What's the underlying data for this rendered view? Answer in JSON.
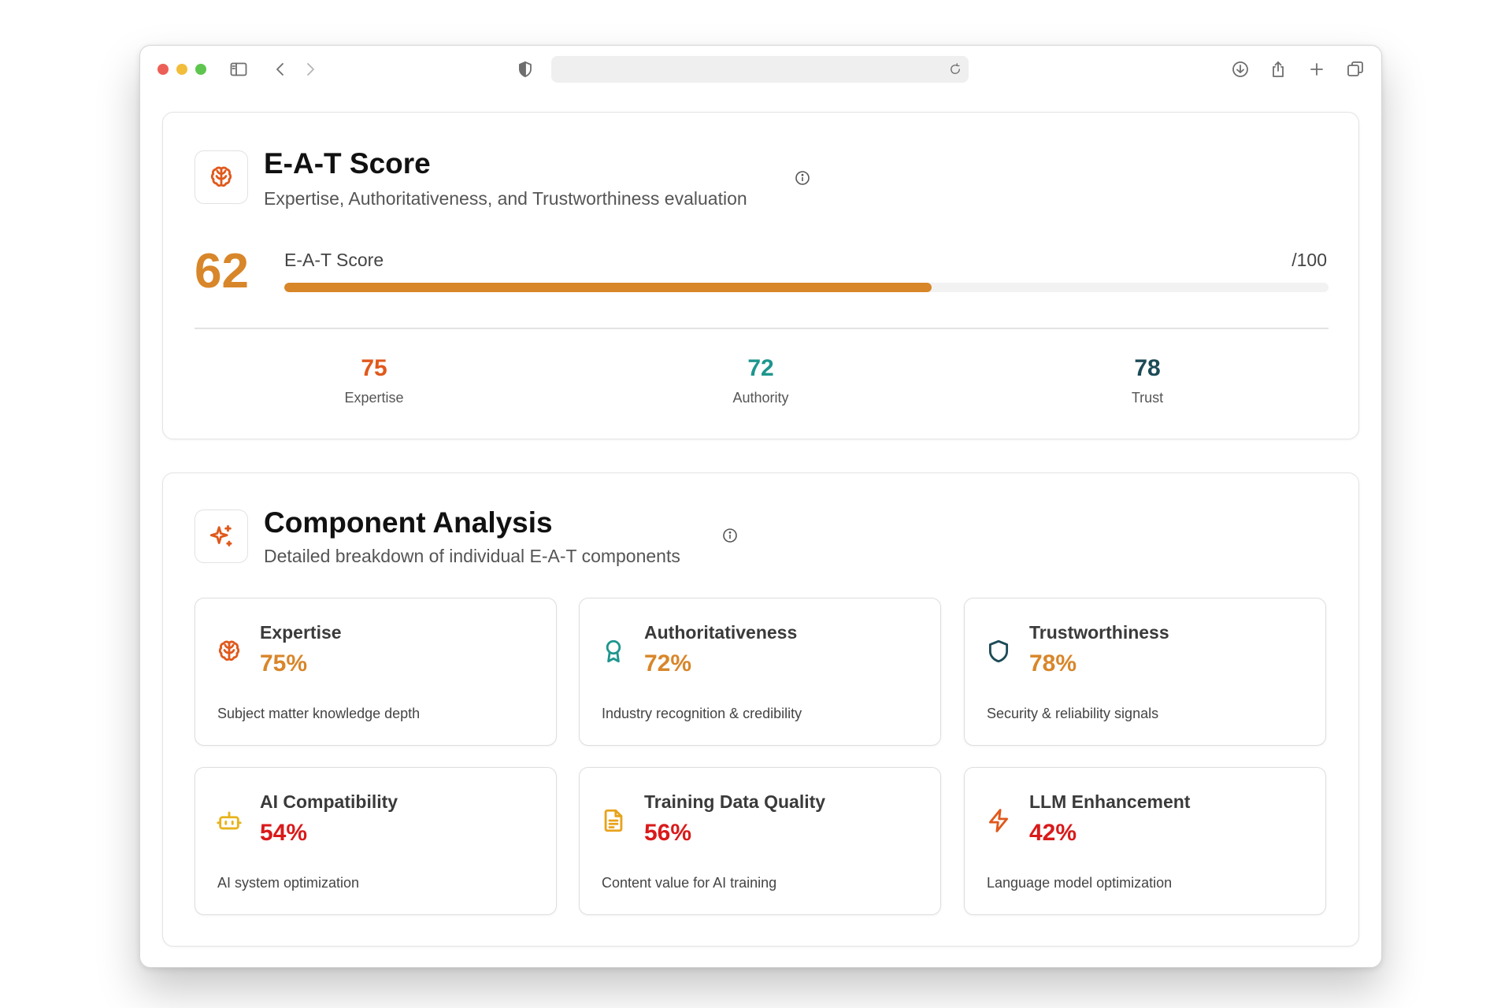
{
  "colors": {
    "accent": "#d8862a",
    "expertise": "#e0591c",
    "authority": "#1e968e",
    "trust": "#1c4b57",
    "low": "#d91a1a",
    "mid": "#d8862a"
  },
  "toolbar_icons": [
    "sidebar-icon",
    "back-icon",
    "forward-icon",
    "shield-icon",
    "reload-icon",
    "download-icon",
    "share-icon",
    "new-tab-icon",
    "tabs-icon"
  ],
  "eat_card": {
    "icon": "brain-icon",
    "title": "E-A-T Score",
    "subtitle": "Expertise, Authoritativeness, and Trustworthiness evaluation",
    "score": "62",
    "score_fraction": 0.62,
    "bar_label": "E-A-T Score",
    "bar_max": "/100",
    "sub_scores": [
      {
        "value": "75",
        "label": "Expertise"
      },
      {
        "value": "72",
        "label": "Authority"
      },
      {
        "value": "78",
        "label": "Trust"
      }
    ]
  },
  "component_card": {
    "icon": "sparkles-icon",
    "title": "Component Analysis",
    "subtitle": "Detailed breakdown of individual E-A-T components",
    "components": [
      {
        "icon": "brain-icon",
        "title": "Expertise",
        "value": "75%",
        "desc": "Subject matter knowledge depth"
      },
      {
        "icon": "award-icon",
        "title": "Authoritativeness",
        "value": "72%",
        "desc": "Industry recognition & credibility"
      },
      {
        "icon": "shield-icon",
        "title": "Trustworthiness",
        "value": "78%",
        "desc": "Security & reliability signals"
      },
      {
        "icon": "bot-icon",
        "title": "AI Compatibility",
        "value": "54%",
        "desc": "AI system optimization"
      },
      {
        "icon": "file-text-icon",
        "title": "Training Data Quality",
        "value": "56%",
        "desc": "Content value for AI training"
      },
      {
        "icon": "zap-icon",
        "title": "LLM Enhancement",
        "value": "42%",
        "desc": "Language model optimization"
      }
    ]
  }
}
